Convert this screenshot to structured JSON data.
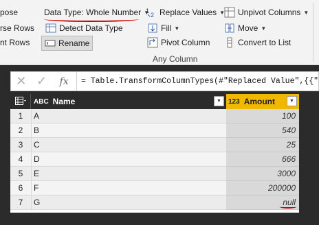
{
  "ribbon": {
    "left_cut_1": "pose",
    "left_cut_2": "rse Rows",
    "left_cut_3": "nt Rows",
    "data_type_label": "Data Type: Whole Number",
    "detect_data_type": "Detect Data Type",
    "rename": "Rename",
    "replace_values": "Replace Values",
    "fill": "Fill",
    "pivot_column": "Pivot Column",
    "unpivot_columns": "Unpivot Columns",
    "move": "Move",
    "convert_to_list": "Convert to List",
    "group_label": "Any Column",
    "accent": "#d00000"
  },
  "formula_bar": {
    "cancel_icon": "close-icon",
    "commit_icon": "check-icon",
    "fx": "fx",
    "formula": "= Table.TransformColumnTypes(#\"Replaced Value\",{{\""
  },
  "grid": {
    "columns": [
      {
        "type": "ABC",
        "name": "Name"
      },
      {
        "type": "123",
        "name": "Amount"
      }
    ],
    "rows": [
      {
        "num": "1",
        "name": "A",
        "amount": "100"
      },
      {
        "num": "2",
        "name": "B",
        "amount": "540"
      },
      {
        "num": "3",
        "name": "C",
        "amount": "25"
      },
      {
        "num": "4",
        "name": "D",
        "amount": "666"
      },
      {
        "num": "5",
        "name": "E",
        "amount": "3000"
      },
      {
        "num": "6",
        "name": "F",
        "amount": "200000"
      },
      {
        "num": "7",
        "name": "G",
        "amount": "null"
      }
    ],
    "amount_header_color": "#f0b800"
  }
}
